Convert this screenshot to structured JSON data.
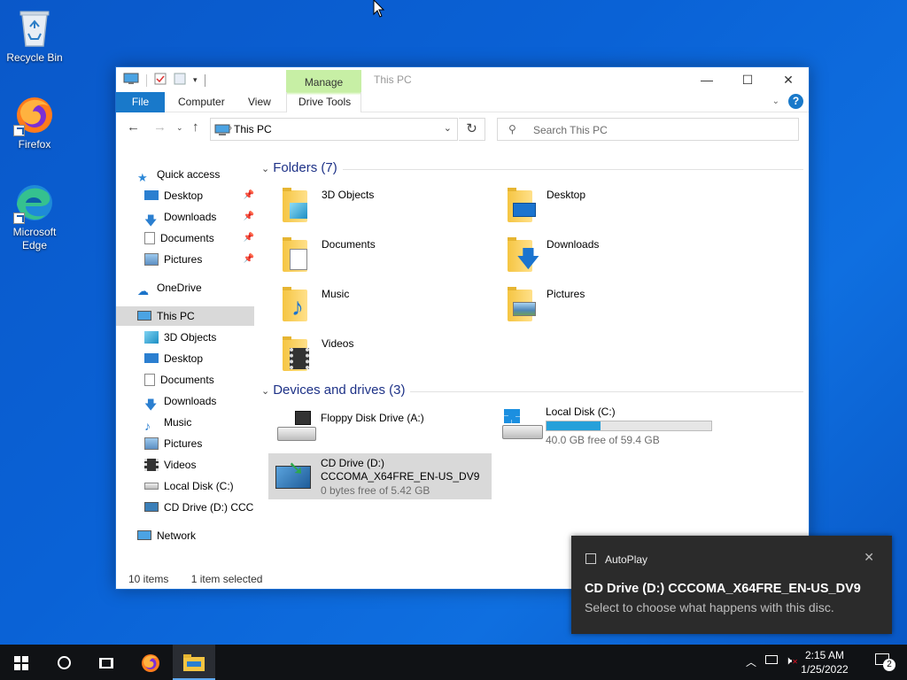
{
  "desktop": {
    "icons": [
      {
        "label": "Recycle Bin"
      },
      {
        "label": "Firefox"
      },
      {
        "label": "Microsoft Edge"
      }
    ]
  },
  "window": {
    "title": "This PC",
    "manage_tab": "Manage",
    "ribbon_tabs": [
      "File",
      "Computer",
      "View",
      "Drive Tools"
    ],
    "address_crumb": "This PC",
    "search_placeholder": "Search This PC"
  },
  "nav": {
    "quick_access": "Quick access",
    "quick_items": [
      "Desktop",
      "Downloads",
      "Documents",
      "Pictures"
    ],
    "onedrive": "OneDrive",
    "this_pc": "This PC",
    "pc_items": [
      "3D Objects",
      "Desktop",
      "Documents",
      "Downloads",
      "Music",
      "Pictures",
      "Videos",
      "Local Disk (C:)",
      "CD Drive (D:) CCCOMA_X64FRE_EN-US_DV9"
    ],
    "network": "Network"
  },
  "folders": {
    "header": "Folders (7)",
    "items": [
      "3D Objects",
      "Desktop",
      "Documents",
      "Downloads",
      "Music",
      "Pictures",
      "Videos"
    ]
  },
  "drives": {
    "header": "Devices and drives (3)",
    "floppy": "Floppy Disk Drive (A:)",
    "local_name": "Local Disk (C:)",
    "local_free": "40.0 GB free of 59.4 GB",
    "local_used_fraction": 0.33,
    "cd_name": "CD Drive (D:)",
    "cd_label": "CCCOMA_X64FRE_EN-US_DV9",
    "cd_free": "0 bytes free of 5.42 GB"
  },
  "status": {
    "items": "10 items",
    "selected": "1 item selected"
  },
  "toast": {
    "app": "AutoPlay",
    "title": "CD Drive (D:) CCCOMA_X64FRE_EN-US_DV9",
    "body": "Select to choose what happens with this disc."
  },
  "taskbar": {
    "time": "2:15 AM",
    "date": "1/25/2022",
    "notif_count": "2"
  },
  "colors": {
    "accent": "#1979ca",
    "selection": "#d9d9d9",
    "manage_tab": "#c7efa5",
    "desktop": "#0a62d6"
  }
}
